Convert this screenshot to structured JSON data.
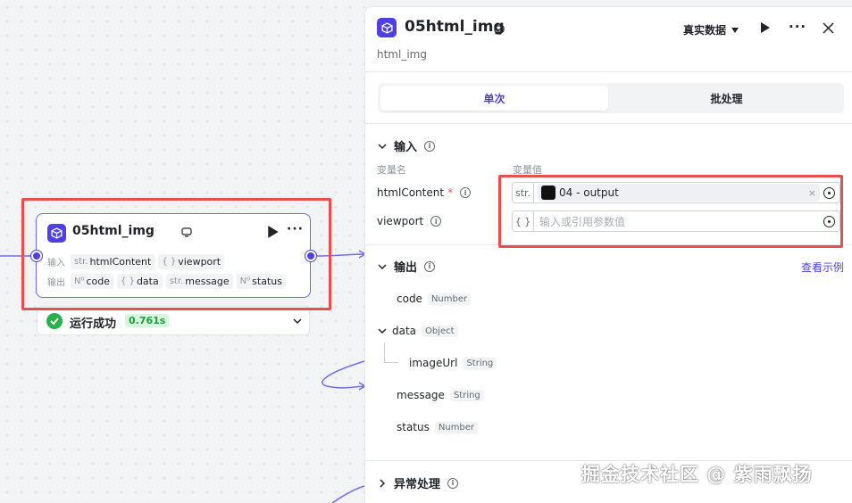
{
  "node": {
    "title": "05html_img",
    "input_label": "输入",
    "output_label": "输出",
    "inputs": [
      {
        "type": "str.",
        "name": "htmlContent"
      },
      {
        "type": "{ }",
        "name": "viewport"
      }
    ],
    "outputs": [
      {
        "type": "N⁰",
        "name": "code"
      },
      {
        "type": "{ }",
        "name": "data"
      },
      {
        "type": "str.",
        "name": "message"
      },
      {
        "type": "N⁰",
        "name": "status"
      }
    ]
  },
  "run_status": {
    "text": "运行成功",
    "time": "0.761s"
  },
  "panel": {
    "title": "05html_img",
    "subtitle": "html_img",
    "data_mode": "真实数据",
    "tabs": [
      "单次",
      "批处理"
    ],
    "input_section": {
      "title": "输入",
      "col_name": "变量名",
      "col_value": "变量值",
      "rows": [
        {
          "name": "htmlContent",
          "required": "*",
          "type": "str.",
          "ref": "04 - output",
          "clear": "×"
        },
        {
          "name": "viewport",
          "type": "{ }",
          "placeholder": "输入或引用参数值"
        }
      ]
    },
    "output_section": {
      "title": "输出",
      "example_link": "查看示例",
      "fields": [
        {
          "name": "code",
          "type": "Number"
        },
        {
          "name": "data",
          "type": "Object"
        },
        {
          "name": "imageUrl",
          "type": "String"
        },
        {
          "name": "message",
          "type": "String"
        },
        {
          "name": "status",
          "type": "Number"
        }
      ]
    },
    "exception_section": {
      "title": "异常处理"
    }
  },
  "watermark": "掘金技术社区 @ 紫雨飘扬",
  "colors": {
    "accent": "#4e40e5",
    "highlight": "#e8504f",
    "success": "#28b34a"
  }
}
